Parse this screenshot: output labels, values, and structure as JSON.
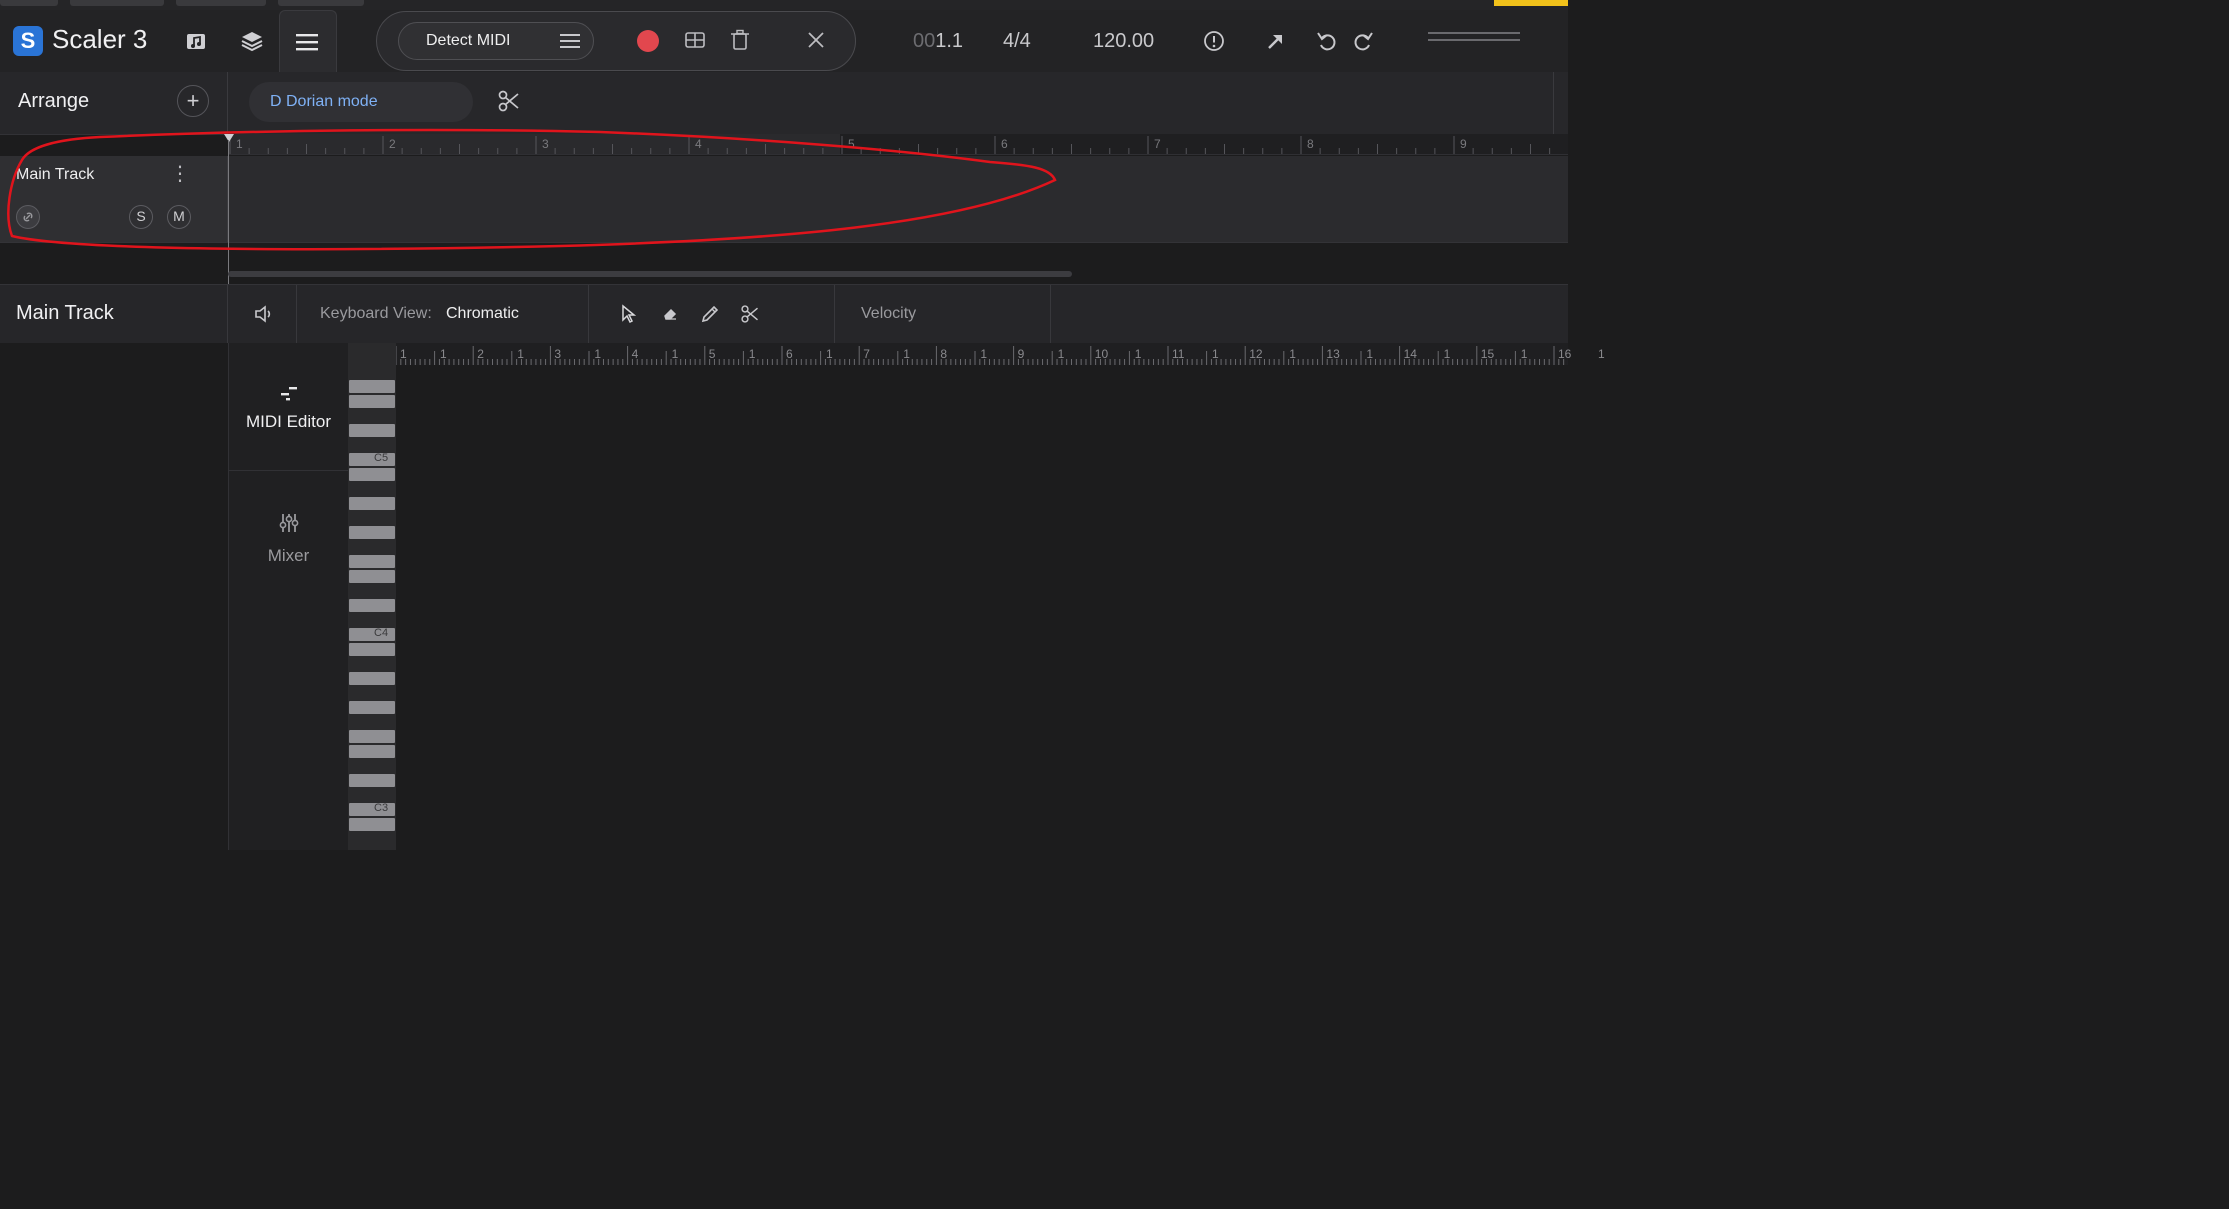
{
  "header": {
    "app_title": "Scaler 3",
    "logo_letter": "S",
    "detect_label": "Detect MIDI",
    "position_dim": "00",
    "position_val": "1.1",
    "time_signature": "4/4",
    "tempo": "120.00"
  },
  "arrange": {
    "title": "Arrange",
    "add_symbol": "+",
    "scale_label": "D Dorian mode"
  },
  "timeline": {
    "bar_numbers": [
      "1",
      "2",
      "3",
      "4",
      "5",
      "6",
      "7",
      "8",
      "9"
    ]
  },
  "track": {
    "name": "Main Track",
    "solo_label": "S",
    "mute_label": "M"
  },
  "editor": {
    "title": "Main Track",
    "keyboard_view_label": "Keyboard View:",
    "keyboard_view_value": "Chromatic",
    "velocity_label": "Velocity"
  },
  "side": {
    "midi_editor_label": "MIDI Editor",
    "mixer_label": "Mixer"
  },
  "piano": {
    "octave_labels": [
      "C5",
      "C4",
      "C3"
    ]
  },
  "roll": {
    "bar_numbers": [
      "1",
      "2",
      "3",
      "4",
      "5",
      "6",
      "7",
      "8",
      "9",
      "10",
      "11",
      "12",
      "13",
      "14",
      "15",
      "16"
    ],
    "beat_label": "1"
  },
  "colors": {
    "accent_blue": "#2a74d6",
    "record_red": "#e2474e",
    "scale_text": "#7fb1f5",
    "annotation_red": "#e0141c"
  }
}
